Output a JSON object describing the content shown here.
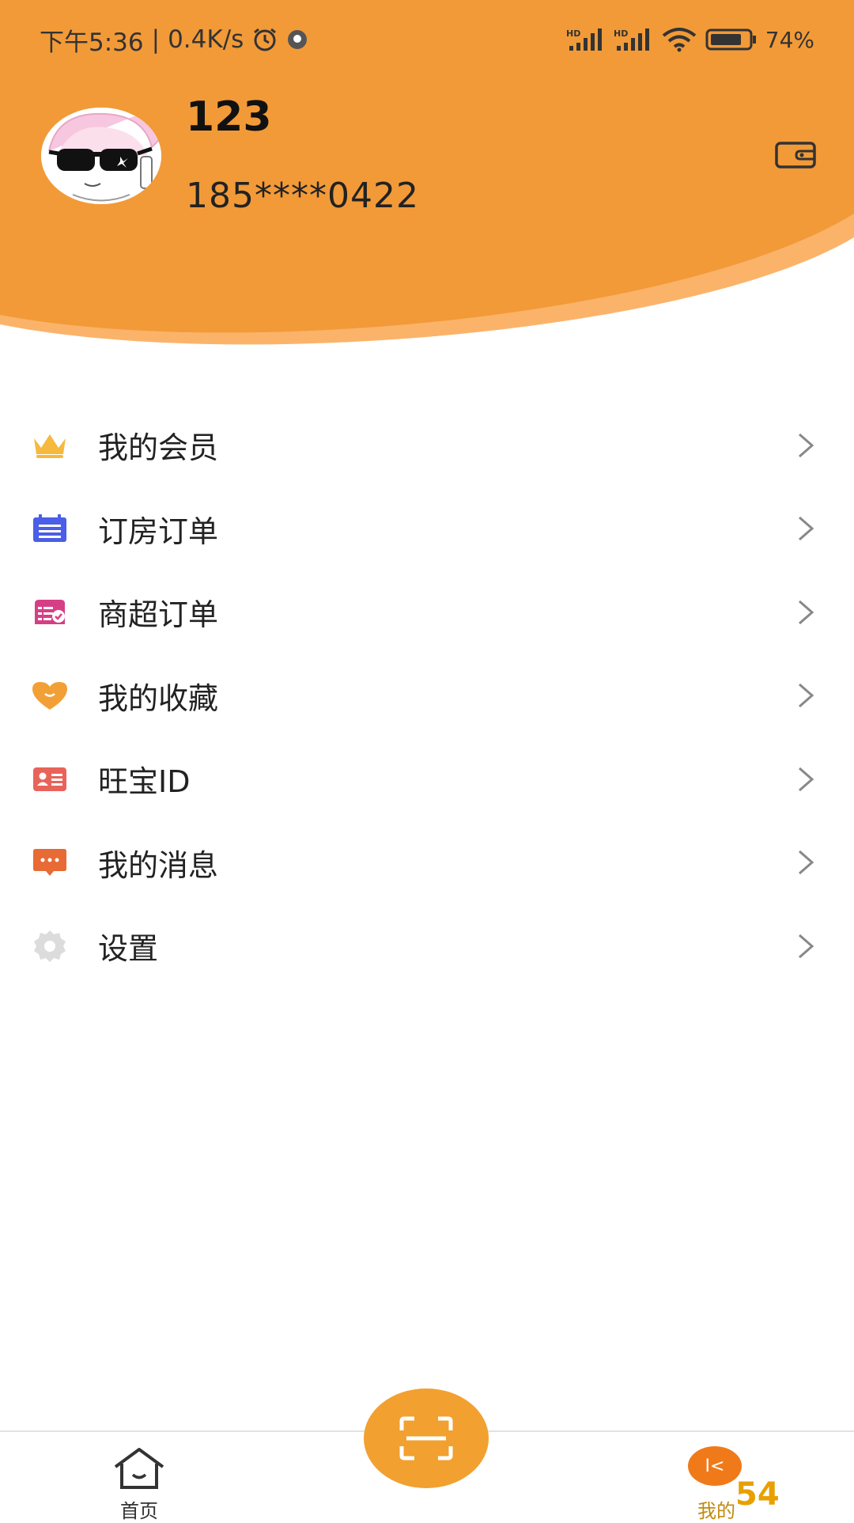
{
  "status_bar": {
    "time": "下午5:36",
    "network_speed": "0.4K/s",
    "signal_label_1": "HD",
    "signal_label_2": "HD",
    "battery": "74%"
  },
  "profile": {
    "username": "123",
    "phone": "185****0422"
  },
  "menu": {
    "items": [
      {
        "label": "我的会员",
        "icon": "crown-icon",
        "color": "#f5b93e"
      },
      {
        "label": "订房订单",
        "icon": "calendar-list-icon",
        "color": "#4a5ee8"
      },
      {
        "label": "商超订单",
        "icon": "store-order-icon",
        "color": "#d63f86"
      },
      {
        "label": "我的收藏",
        "icon": "heart-icon",
        "color": "#f2a036"
      },
      {
        "label": "旺宝ID",
        "icon": "id-card-icon",
        "color": "#e8645a"
      },
      {
        "label": "我的消息",
        "icon": "message-icon",
        "color": "#e86a35"
      },
      {
        "label": "设置",
        "icon": "gear-icon",
        "color": "#d9d9d9"
      }
    ]
  },
  "bottom_nav": {
    "home_label": "首页",
    "mine_label": "我的",
    "mine_badge": "I<"
  },
  "watermark": "54",
  "colors": {
    "header_orange": "#f29a38",
    "header_light": "#fbb36a",
    "scan_button": "#f2a02f"
  }
}
